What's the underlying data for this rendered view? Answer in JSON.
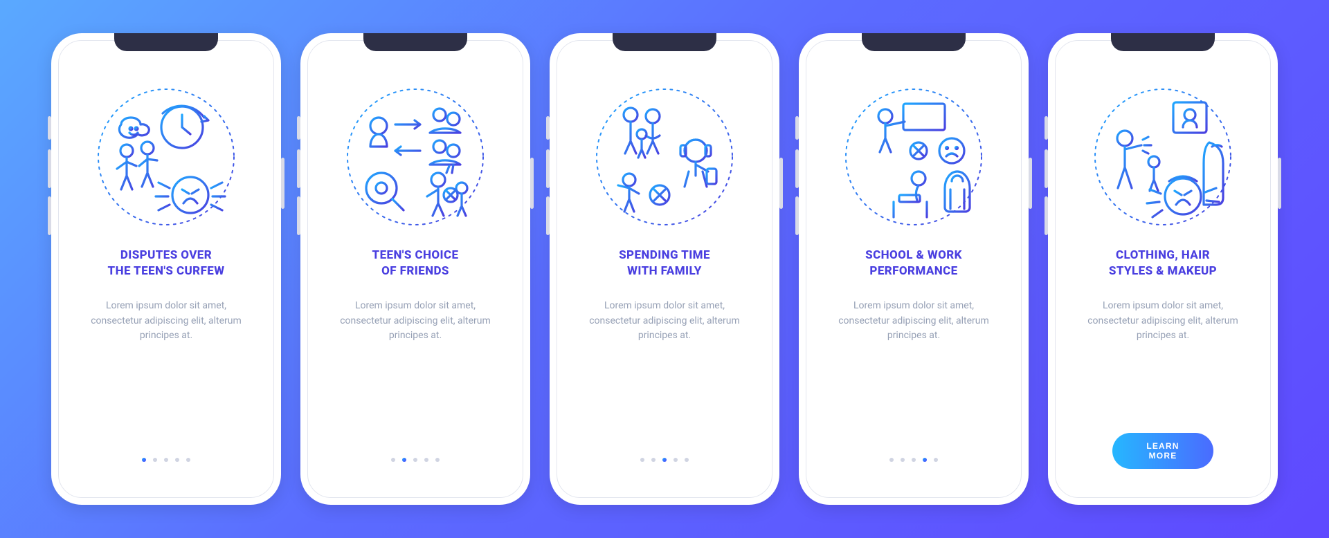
{
  "common": {
    "desc": "Lorem ipsum dolor sit amet, consectetur adipiscing elit, alterum principes at.",
    "cta_label": "LEARN MORE"
  },
  "cards": [
    {
      "title": "DISPUTES OVER\nTHE TEEN'S CURFEW",
      "icon": "curfew-icon"
    },
    {
      "title": "TEEN'S CHOICE\nOF FRIENDS",
      "icon": "friends-icon"
    },
    {
      "title": "SPENDING TIME\nWITH FAMILY",
      "icon": "family-time-icon"
    },
    {
      "title": "SCHOOL & WORK\nPERFORMANCE",
      "icon": "school-performance-icon"
    },
    {
      "title": "CLOTHING, HAIR\nSTYLES & MAKEUP",
      "icon": "appearance-icon"
    }
  ]
}
